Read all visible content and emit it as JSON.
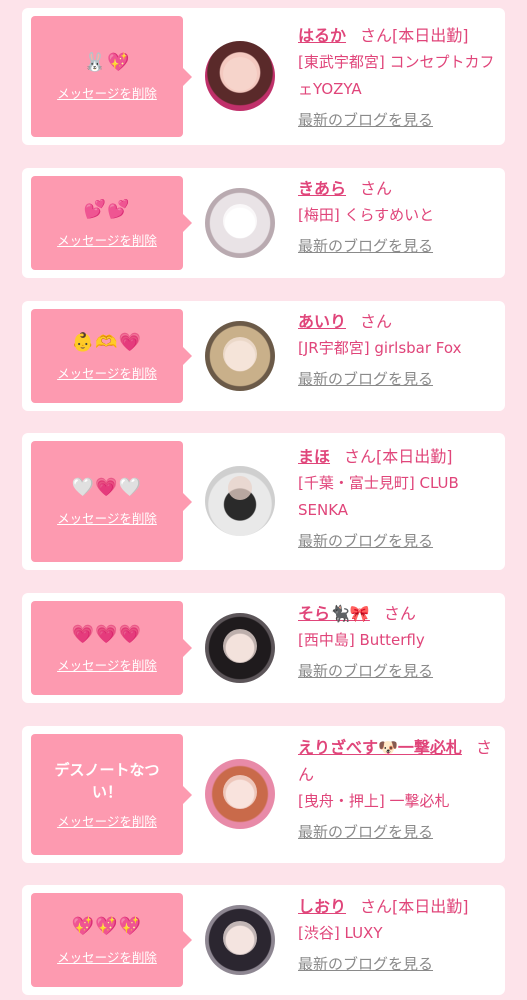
{
  "ui": {
    "delete_label": "メッセージを削除",
    "blog_label": "最新のブログを見る",
    "san_label": "さん",
    "accent_color": "#e0457a",
    "bubble_color": "#fd9ab0"
  },
  "entries": [
    {
      "message": "🐰💖",
      "name": "はるか",
      "status": "[本日出勤]",
      "shop": "[東武宇都宮] コンセプトカフェYOZYA"
    },
    {
      "message": "💕💕",
      "name": "きあら",
      "status": "",
      "shop": "[梅田] くらすめいと"
    },
    {
      "message": "👶🫶💗",
      "name": "あいり",
      "status": "",
      "shop": "[JR宇都宮] girlsbar Fox"
    },
    {
      "message": "🤍💗🤍",
      "name": "まほ",
      "status": "[本日出勤]",
      "shop": "[千葉・富士見町] CLUB SENKA"
    },
    {
      "message": "💗💗💗",
      "name": "そら🐈‍⬛🎀",
      "status": "",
      "shop": "[西中島] Butterfly"
    },
    {
      "message": "デスノートなつい！",
      "name": "えりざべす🐶一撃必札",
      "status": "",
      "shop": "[曳舟・押上] 一撃必札"
    },
    {
      "message": "💖💖💖",
      "name": "しおり",
      "status": "[本日出勤]",
      "shop": "[渋谷] LUXY"
    }
  ]
}
